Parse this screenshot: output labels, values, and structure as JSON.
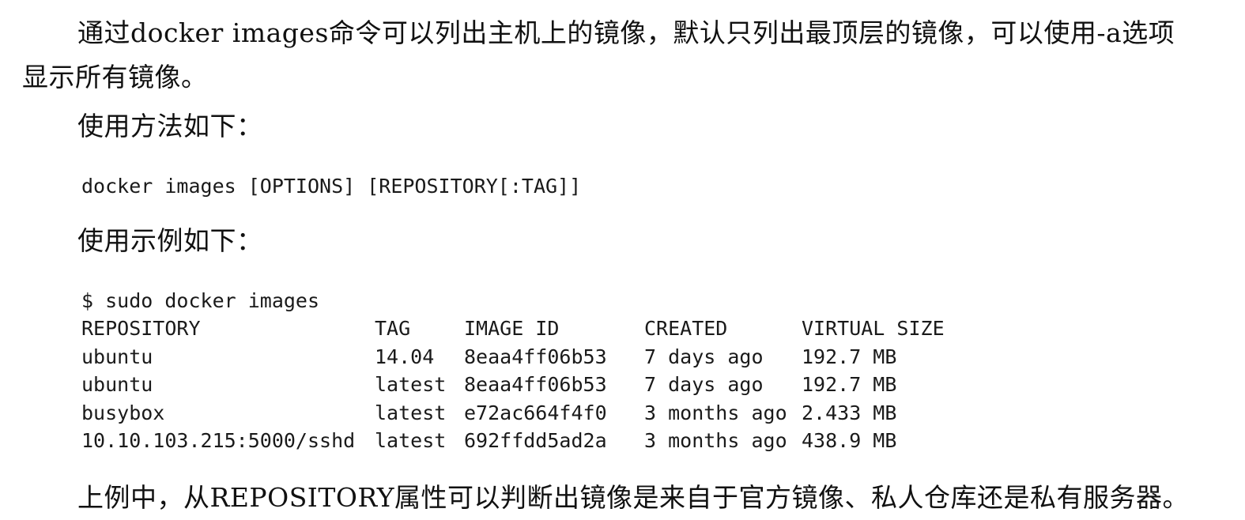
{
  "paragraphs": {
    "intro": "通过docker images命令可以列出主机上的镜像，默认只列出最顶层的镜像，可以使用-a选项显示所有镜像。",
    "conclusion": "上例中，从REPOSITORY属性可以判断出镜像是来自于官方镜像、私人仓库还是私有服务器。"
  },
  "headings": {
    "usage": "使用方法如下：",
    "example": "使用示例如下："
  },
  "code": {
    "syntax": "docker images [OPTIONS] [REPOSITORY[:TAG]]",
    "command": "$ sudo docker images"
  },
  "table": {
    "headers": [
      "REPOSITORY",
      "TAG",
      "IMAGE ID",
      "CREATED",
      "VIRTUAL SIZE"
    ],
    "rows": [
      [
        "ubuntu",
        "14.04",
        "8eaa4ff06b53",
        "7 days ago",
        "192.7 MB"
      ],
      [
        "ubuntu",
        "latest",
        "8eaa4ff06b53",
        "7 days ago",
        "192.7 MB"
      ],
      [
        "busybox",
        "latest",
        "e72ac664f4f0",
        "3 months ago",
        "2.433 MB"
      ],
      [
        "10.10.103.215:5000/sshd",
        "latest",
        "692ffdd5ad2a",
        "3 months ago",
        "438.9 MB"
      ]
    ]
  }
}
